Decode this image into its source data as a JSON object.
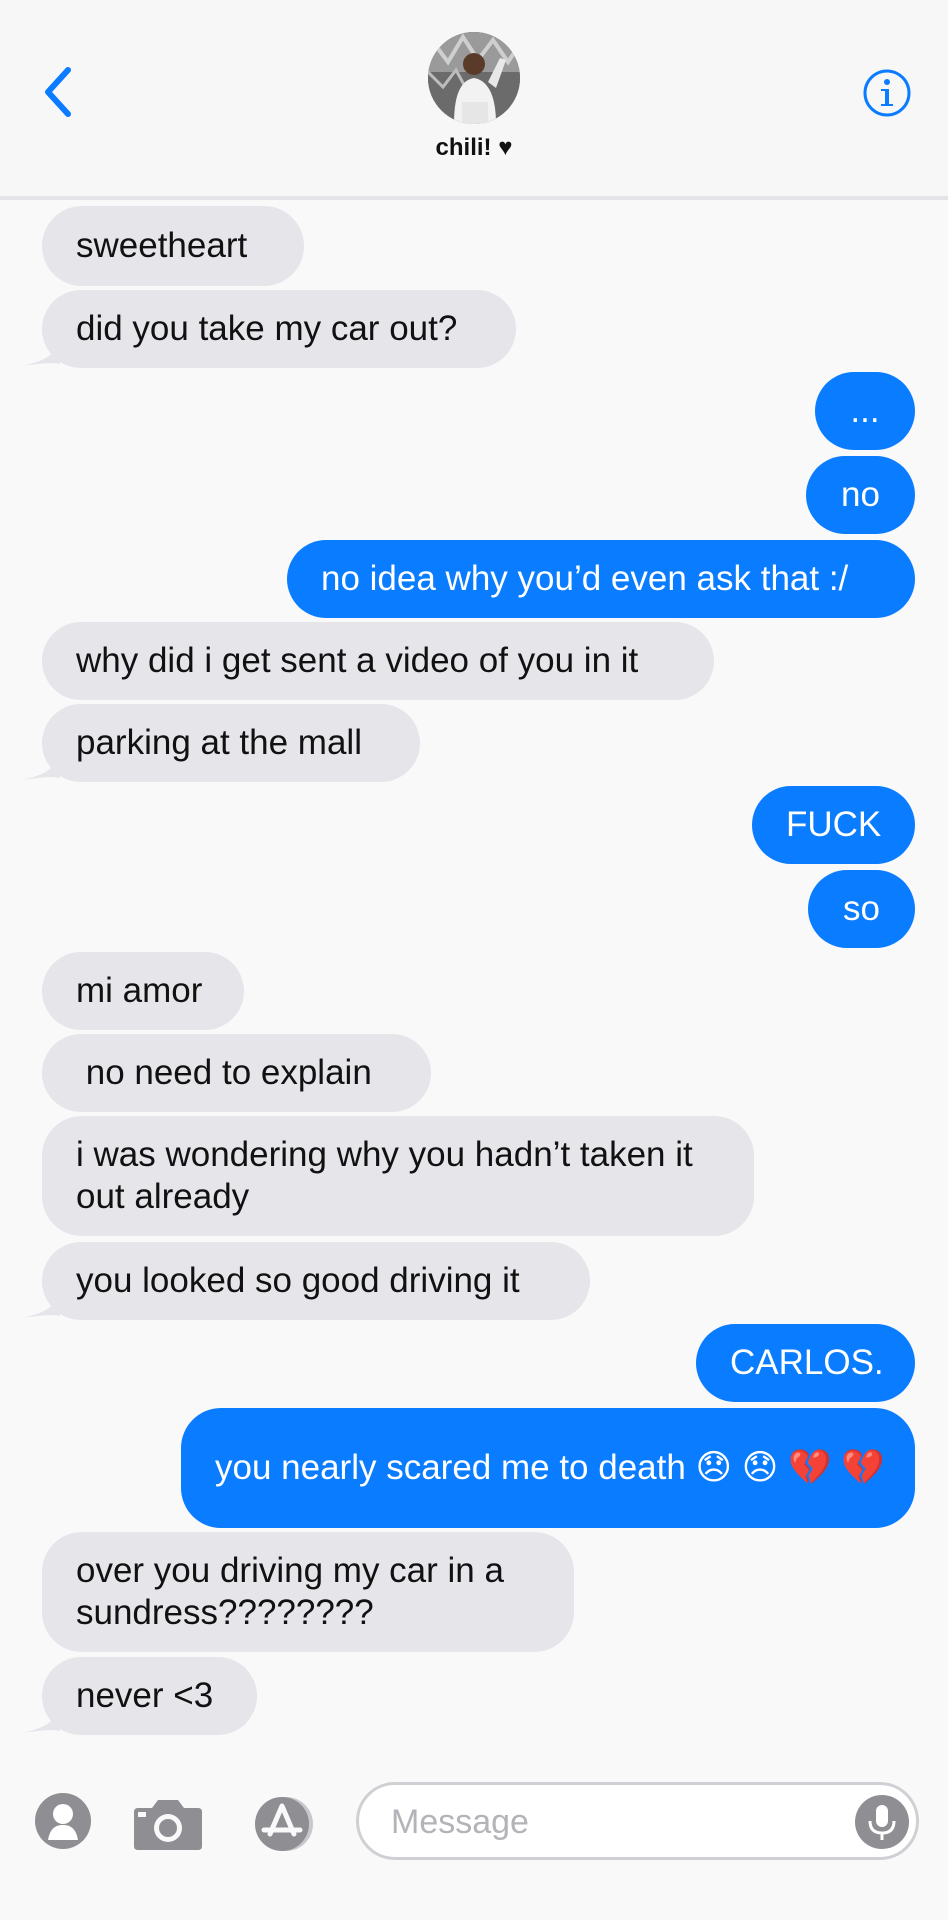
{
  "contact": {
    "name": "chili! ♥"
  },
  "messages": [
    {
      "side": "in",
      "text": "sweetheart"
    },
    {
      "side": "in",
      "text": "did you take my car out?"
    },
    {
      "side": "out",
      "text": "..."
    },
    {
      "side": "out",
      "text": "no"
    },
    {
      "side": "out",
      "text": "no idea why you’d even ask that :/"
    },
    {
      "side": "in",
      "text": "why did i get sent a video of you in it"
    },
    {
      "side": "in",
      "text": "parking at the mall"
    },
    {
      "side": "out",
      "text": "FUCK"
    },
    {
      "side": "out",
      "text": "so"
    },
    {
      "side": "in",
      "text": "mi amor"
    },
    {
      "side": "in",
      "text": " no need to explain"
    },
    {
      "side": "in",
      "text": "i was wondering why you hadn’t taken it out already"
    },
    {
      "side": "in",
      "text": "you looked so good driving it"
    },
    {
      "side": "out",
      "text": "CARLOS."
    },
    {
      "side": "out",
      "text": "you nearly scared me to death 😞 😞 💔 💔"
    },
    {
      "side": "in",
      "text": "over you driving my car in a sundress????????"
    },
    {
      "side": "in",
      "text": "never <3"
    }
  ],
  "composer": {
    "placeholder": "Message"
  },
  "colors": {
    "outgoing": "#0a7cff",
    "incoming": "#e5e5ea",
    "accent": "#0a7cff"
  },
  "icons": [
    "chevron-left-icon",
    "info-icon",
    "memoji-icon",
    "camera-icon",
    "app-store-icon",
    "microphone-icon"
  ]
}
